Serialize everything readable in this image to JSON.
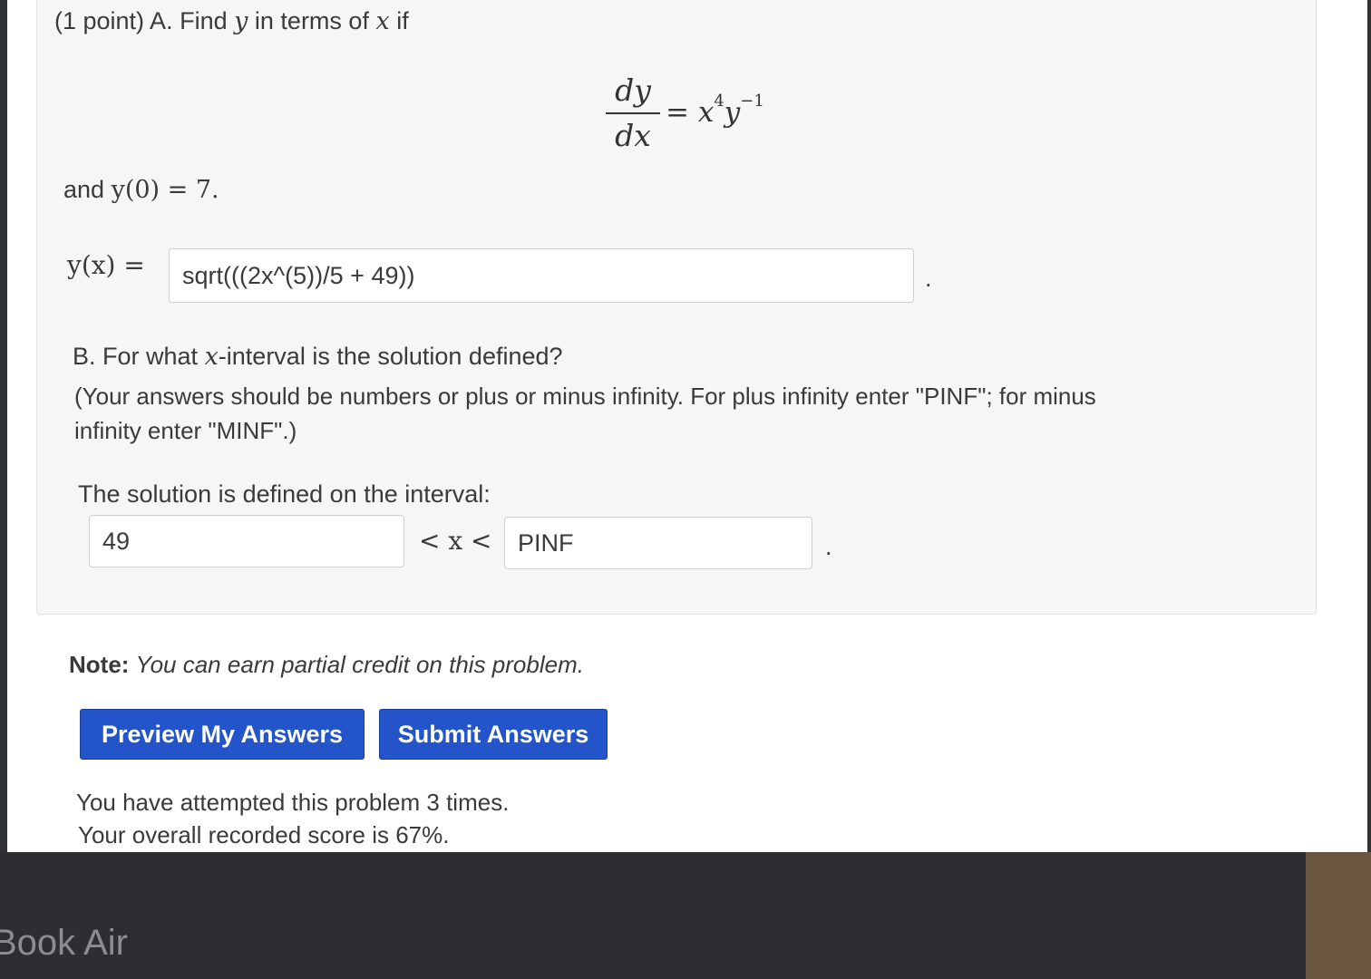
{
  "part_a": {
    "intro_prefix": "(1 point) A. Find",
    "intro_y": "y",
    "intro_mid": "in terms of",
    "intro_x": "x",
    "intro_suffix": "if",
    "equation": {
      "numerator": "dy",
      "denominator": "dx",
      "equals": "=",
      "rhs_x": "x",
      "rhs_x_exp": "4",
      "rhs_y": "y",
      "rhs_y_exp": "−1"
    },
    "initial_condition_prefix": "and",
    "initial_condition": "y(0) = 7.",
    "answer_label": "y(x) =",
    "answer_value": "sqrt(((2x^(5))/5 + 49))",
    "answer_trailing": "."
  },
  "part_b": {
    "question_prefix": "B. For what",
    "question_x": "x",
    "question_suffix": "-interval is the solution defined?",
    "instructions_line1": "(Your answers should be numbers or plus or minus infinity. For plus infinity enter \"PINF\"; for minus",
    "instructions_line2": "infinity enter \"MINF\".)",
    "interval_label": "The solution is defined on the interval:",
    "lower_value": "49",
    "inequality": "< x <",
    "upper_value": "PINF",
    "trailing": "."
  },
  "note": {
    "label": "Note:",
    "text": "You can earn partial credit on this problem."
  },
  "buttons": {
    "preview": "Preview My Answers",
    "submit": "Submit Answers"
  },
  "status": {
    "attempts": "You have attempted this problem 3 times.",
    "score": "Your overall recorded score is 67%."
  },
  "device": {
    "brand": "Book Air"
  },
  "colors": {
    "button_blue": "#2354c9",
    "panel_bg": "#f6f6f6"
  }
}
